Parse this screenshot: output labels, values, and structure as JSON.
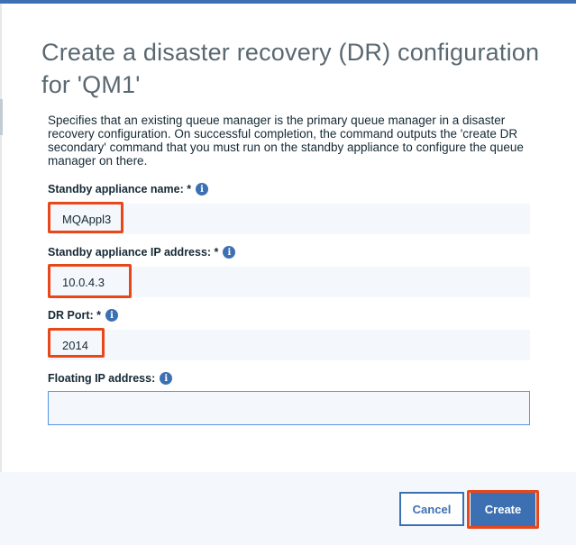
{
  "dialog": {
    "title": "Create a disaster recovery (DR) configuration for 'QM1'",
    "description": "Specifies that an existing queue manager is the primary queue manager in a disaster recovery configuration. On successful completion, the command outputs the 'create DR secondary' command that you must run on the standby appliance to configure the queue manager on there."
  },
  "fields": {
    "standby_name": {
      "label": "Standby appliance name: *",
      "value": "MQAppl3"
    },
    "standby_ip": {
      "label": "Standby appliance IP address: *",
      "value": "10.0.4.3"
    },
    "dr_port": {
      "label": "DR Port: *",
      "value": "2014"
    },
    "floating_ip": {
      "label": "Floating IP address:",
      "value": ""
    }
  },
  "icons": {
    "info": "info-icon"
  },
  "buttons": {
    "cancel": "Cancel",
    "create": "Create"
  },
  "colors": {
    "accent": "#3d70b2",
    "highlight": "#e8471a"
  }
}
